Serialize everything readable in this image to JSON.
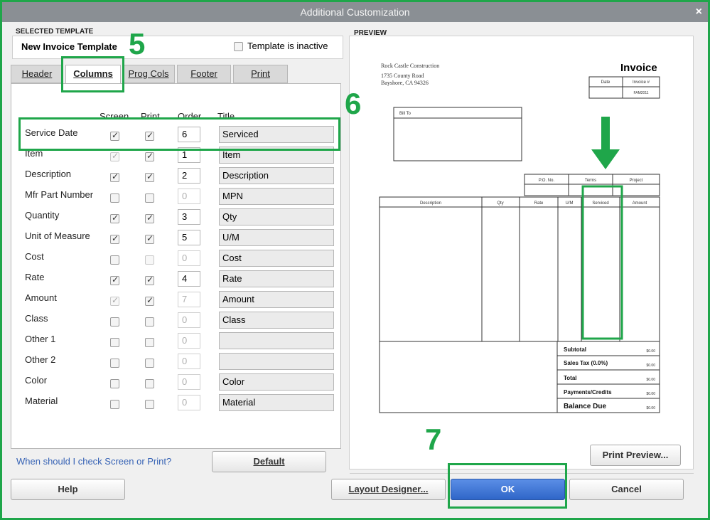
{
  "window": {
    "title": "Additional Customization",
    "close": "×"
  },
  "selected_template": {
    "group_label": "SELECTED TEMPLATE",
    "name": "New Invoice Template",
    "inactive_label": "Template is inactive"
  },
  "tabs": [
    {
      "label": "Header"
    },
    {
      "label": "Columns"
    },
    {
      "label": "Prog Cols"
    },
    {
      "label": "Footer"
    },
    {
      "label": "Print"
    }
  ],
  "column_headers": {
    "screen": "Screen",
    "print": "Print",
    "order": "Order",
    "title": "Title"
  },
  "rows": [
    {
      "label": "Service Date",
      "screen": true,
      "screen_disabled": false,
      "print": true,
      "print_disabled": false,
      "order": "6",
      "order_disabled": false,
      "title": "Serviced"
    },
    {
      "label": "Item",
      "screen": true,
      "screen_disabled": true,
      "print": true,
      "print_disabled": false,
      "order": "1",
      "order_disabled": false,
      "title": "Item"
    },
    {
      "label": "Description",
      "screen": true,
      "screen_disabled": false,
      "print": true,
      "print_disabled": false,
      "order": "2",
      "order_disabled": false,
      "title": "Description"
    },
    {
      "label": "Mfr Part Number",
      "screen": false,
      "screen_disabled": false,
      "print": false,
      "print_disabled": false,
      "order": "0",
      "order_disabled": true,
      "title": "MPN"
    },
    {
      "label": "Quantity",
      "screen": true,
      "screen_disabled": false,
      "print": true,
      "print_disabled": false,
      "order": "3",
      "order_disabled": false,
      "title": "Qty"
    },
    {
      "label": "Unit of Measure",
      "screen": true,
      "screen_disabled": false,
      "print": true,
      "print_disabled": false,
      "order": "5",
      "order_disabled": false,
      "title": "U/M"
    },
    {
      "label": "Cost",
      "screen": false,
      "screen_disabled": false,
      "print": false,
      "print_disabled": true,
      "order": "0",
      "order_disabled": true,
      "title": "Cost"
    },
    {
      "label": "Rate",
      "screen": true,
      "screen_disabled": false,
      "print": true,
      "print_disabled": false,
      "order": "4",
      "order_disabled": false,
      "title": "Rate"
    },
    {
      "label": "Amount",
      "screen": true,
      "screen_disabled": true,
      "print": true,
      "print_disabled": false,
      "order": "7",
      "order_disabled": true,
      "title": "Amount"
    },
    {
      "label": "Class",
      "screen": false,
      "screen_disabled": false,
      "print": false,
      "print_disabled": false,
      "order": "0",
      "order_disabled": true,
      "title": "Class"
    },
    {
      "label": "Other 1",
      "screen": false,
      "screen_disabled": false,
      "print": false,
      "print_disabled": false,
      "order": "0",
      "order_disabled": true,
      "title": ""
    },
    {
      "label": "Other 2",
      "screen": false,
      "screen_disabled": false,
      "print": false,
      "print_disabled": false,
      "order": "0",
      "order_disabled": true,
      "title": ""
    },
    {
      "label": "Color",
      "screen": false,
      "screen_disabled": false,
      "print": false,
      "print_disabled": false,
      "order": "0",
      "order_disabled": true,
      "title": "Color"
    },
    {
      "label": "Material",
      "screen": false,
      "screen_disabled": false,
      "print": false,
      "print_disabled": false,
      "order": "0",
      "order_disabled": true,
      "title": "Material"
    }
  ],
  "help_link": "When should I check Screen or Print?",
  "default_button": "Default",
  "preview": {
    "group_label": "PREVIEW",
    "company_name": "Rock Castle Construction",
    "address1": "1735 County Road",
    "address2": "Bayshore, CA 94326",
    "doc_title": "Invoice",
    "date_label": "Date",
    "invoice_no_label": "Invoice #",
    "invoice_no": "FAM2011",
    "bill_to": "Bill To",
    "po_label": "P.O. No.",
    "terms_label": "Terms",
    "project_label": "Project",
    "columns": [
      "Description",
      "Qty",
      "Rate",
      "U/M",
      "Serviced",
      "Amount"
    ],
    "totals": [
      {
        "label": "Subtotal",
        "value": "$0.00"
      },
      {
        "label": "Sales Tax  (0.0%)",
        "value": "$0.00"
      },
      {
        "label": "Total",
        "value": "$0.00"
      },
      {
        "label": "Payments/Credits",
        "value": "$0.00"
      },
      {
        "label": "Balance Due",
        "value": "$0.00"
      }
    ],
    "print_preview_button": "Print Preview..."
  },
  "footer_buttons": {
    "help": "Help",
    "layout_designer": "Layout Designer...",
    "ok": "OK",
    "cancel": "Cancel"
  },
  "annotations": {
    "step5": "5",
    "step6": "6",
    "step7": "7"
  },
  "colors": {
    "annotation_green": "#1fa64a",
    "ok_blue": "#2f66c8",
    "titlebar_gray": "#8a8f94"
  }
}
